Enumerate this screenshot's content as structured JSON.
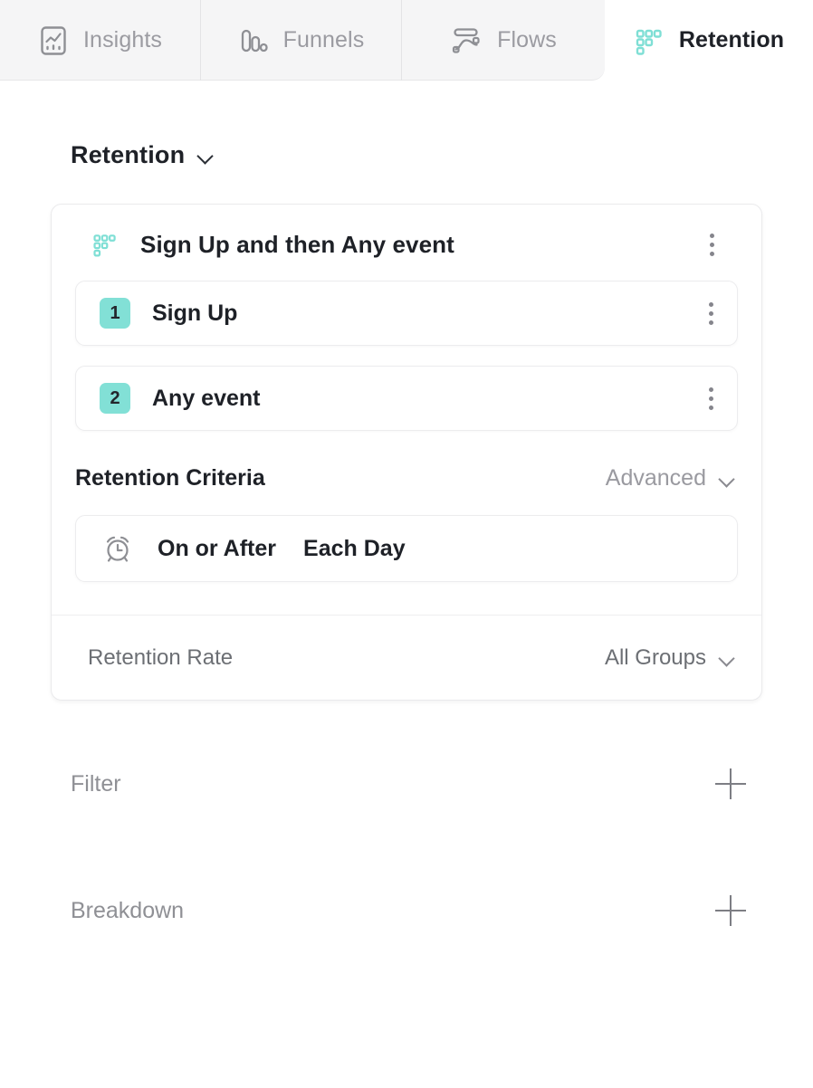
{
  "tabs": [
    {
      "id": "insights",
      "label": "Insights",
      "icon": "insights-chart-icon",
      "active": false
    },
    {
      "id": "funnels",
      "label": "Funnels",
      "icon": "funnels-bars-icon",
      "active": false
    },
    {
      "id": "flows",
      "label": "Flows",
      "icon": "flows-path-icon",
      "active": false
    },
    {
      "id": "retention",
      "label": "Retention",
      "icon": "retention-grid-icon",
      "active": true
    }
  ],
  "page": {
    "title": "Retention",
    "title_dropdown_icon": "chevron-down-icon"
  },
  "card": {
    "icon": "retention-grid-icon",
    "title": "Sign Up and then Any event",
    "menu_icon": "kebab-menu-icon",
    "steps": [
      {
        "number": "1",
        "label": "Sign Up",
        "menu_icon": "kebab-menu-icon"
      },
      {
        "number": "2",
        "label": "Any event",
        "menu_icon": "kebab-menu-icon"
      }
    ],
    "criteria": {
      "title": "Retention Criteria",
      "mode_label": "Advanced",
      "mode_dropdown_icon": "chevron-down-icon",
      "condition_icon": "alarm-clock-icon",
      "condition": "On or After",
      "period": "Each Day"
    },
    "footer": {
      "metric_label": "Retention Rate",
      "groups_label": "All Groups",
      "groups_dropdown_icon": "chevron-down-icon"
    }
  },
  "sections": [
    {
      "id": "filter",
      "label": "Filter",
      "add_icon": "plus-icon"
    },
    {
      "id": "breakdown",
      "label": "Breakdown",
      "add_icon": "plus-icon"
    }
  ],
  "colors": {
    "accent_teal": "#82e0d6",
    "text_dark": "#1e2127",
    "text_muted": "#9a9aa0",
    "tabbar_bg": "#f5f5f6"
  }
}
